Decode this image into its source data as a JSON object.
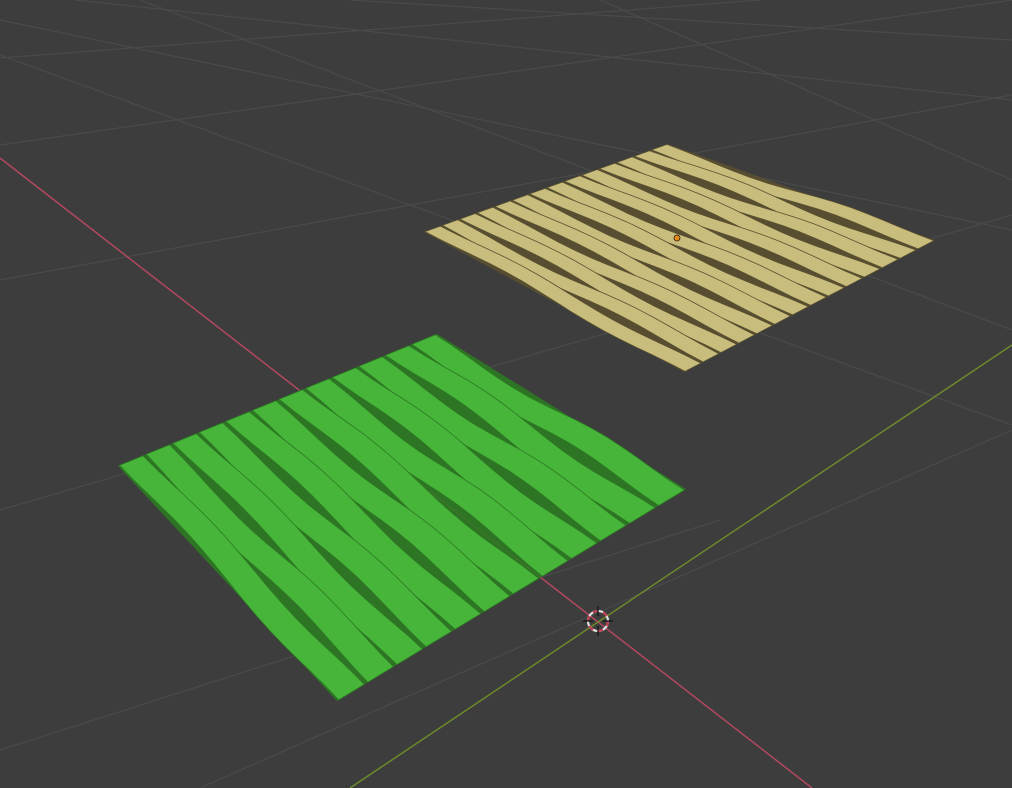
{
  "viewport": {
    "view": "3d-perspective",
    "background_color": "#3d3d3d",
    "grid_color": "#4a4a4a",
    "x_axis_color": "#b3485f",
    "y_axis_color": "#6d8a2b",
    "show_grid": true
  },
  "objects": [
    {
      "name": "woven-plane-selected",
      "selected": true,
      "color": "#47b43a",
      "edge_color": "#2c7a22",
      "strip_count": 12
    },
    {
      "name": "woven-plane",
      "selected": false,
      "color": "#c8bd7c",
      "edge_color": "#5a5030",
      "strip_count": 14,
      "origin_color": "#e08a1e"
    }
  ],
  "cursor": {
    "icon": "3d-cursor-icon",
    "ring_color_a": "#e0e0e0",
    "ring_color_b": "#c0394d"
  }
}
